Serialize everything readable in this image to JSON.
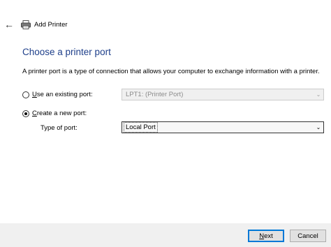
{
  "header": {
    "back_icon": "back-arrow-icon",
    "printer_icon": "printer-icon",
    "title": "Add Printer"
  },
  "main": {
    "heading": "Choose a printer port",
    "description": "A printer port is a type of connection that allows your computer to exchange information with a printer.",
    "existing_port": {
      "label_prefix": "",
      "label_accel": "U",
      "label_rest": "se an existing port:",
      "selected": false,
      "value": "LPT1: (Printer Port)",
      "enabled": false
    },
    "new_port": {
      "label_accel": "C",
      "label_rest": "reate a new port:",
      "selected": true,
      "type_label": "Type of port:",
      "value": "Local Port",
      "enabled": true
    }
  },
  "footer": {
    "next_accel": "N",
    "next_rest": "ext",
    "cancel_label": "Cancel"
  },
  "colors": {
    "heading": "#1e3f8a",
    "primary_button_border": "#0078d7",
    "footer_bg": "#f0f0f0"
  }
}
